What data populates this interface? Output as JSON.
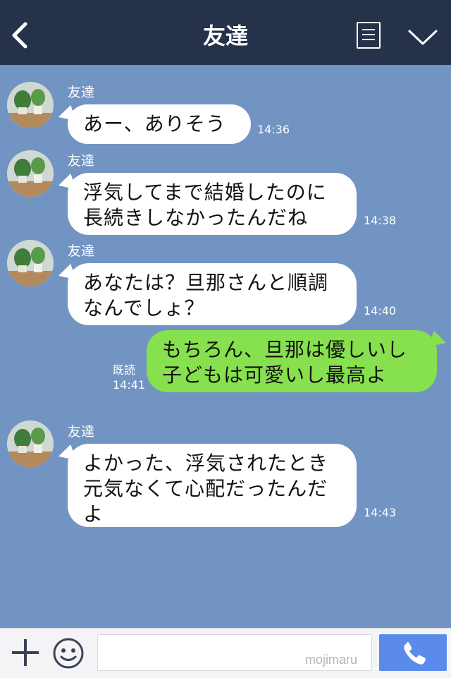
{
  "header": {
    "title": "友達"
  },
  "messages": [
    {
      "sender": "友達",
      "text": "あー、ありそう",
      "time": "14:36"
    },
    {
      "sender": "友達",
      "text": "浮気してまで結婚したのに\n長続きしなかったんだね",
      "time": "14:38"
    },
    {
      "sender": "友達",
      "text": "あなたは？旦那さんと順調\nなんでしょ？",
      "time": "14:40"
    },
    {
      "sender": "me",
      "text": "もちろん、旦那は優しいし\n子どもは可愛いし最高よ",
      "read": "既読",
      "time": "14:41"
    },
    {
      "sender": "友達",
      "text": "よかった、浮気されたとき\n元気なくて心配だったんだ\nよ",
      "time": "14:43"
    }
  ],
  "inputbar": {
    "placeholder": "",
    "watermark": "mojimaru"
  },
  "colors": {
    "header": "#263249",
    "background": "#7294c3",
    "my_bubble": "#87e04d",
    "send_button": "#5a8bea"
  },
  "icons": [
    "back-chevron-icon",
    "menu-list-icon",
    "chevron-down-icon",
    "avatar-plant-icon",
    "plus-icon",
    "emoji-icon",
    "phone-icon"
  ]
}
